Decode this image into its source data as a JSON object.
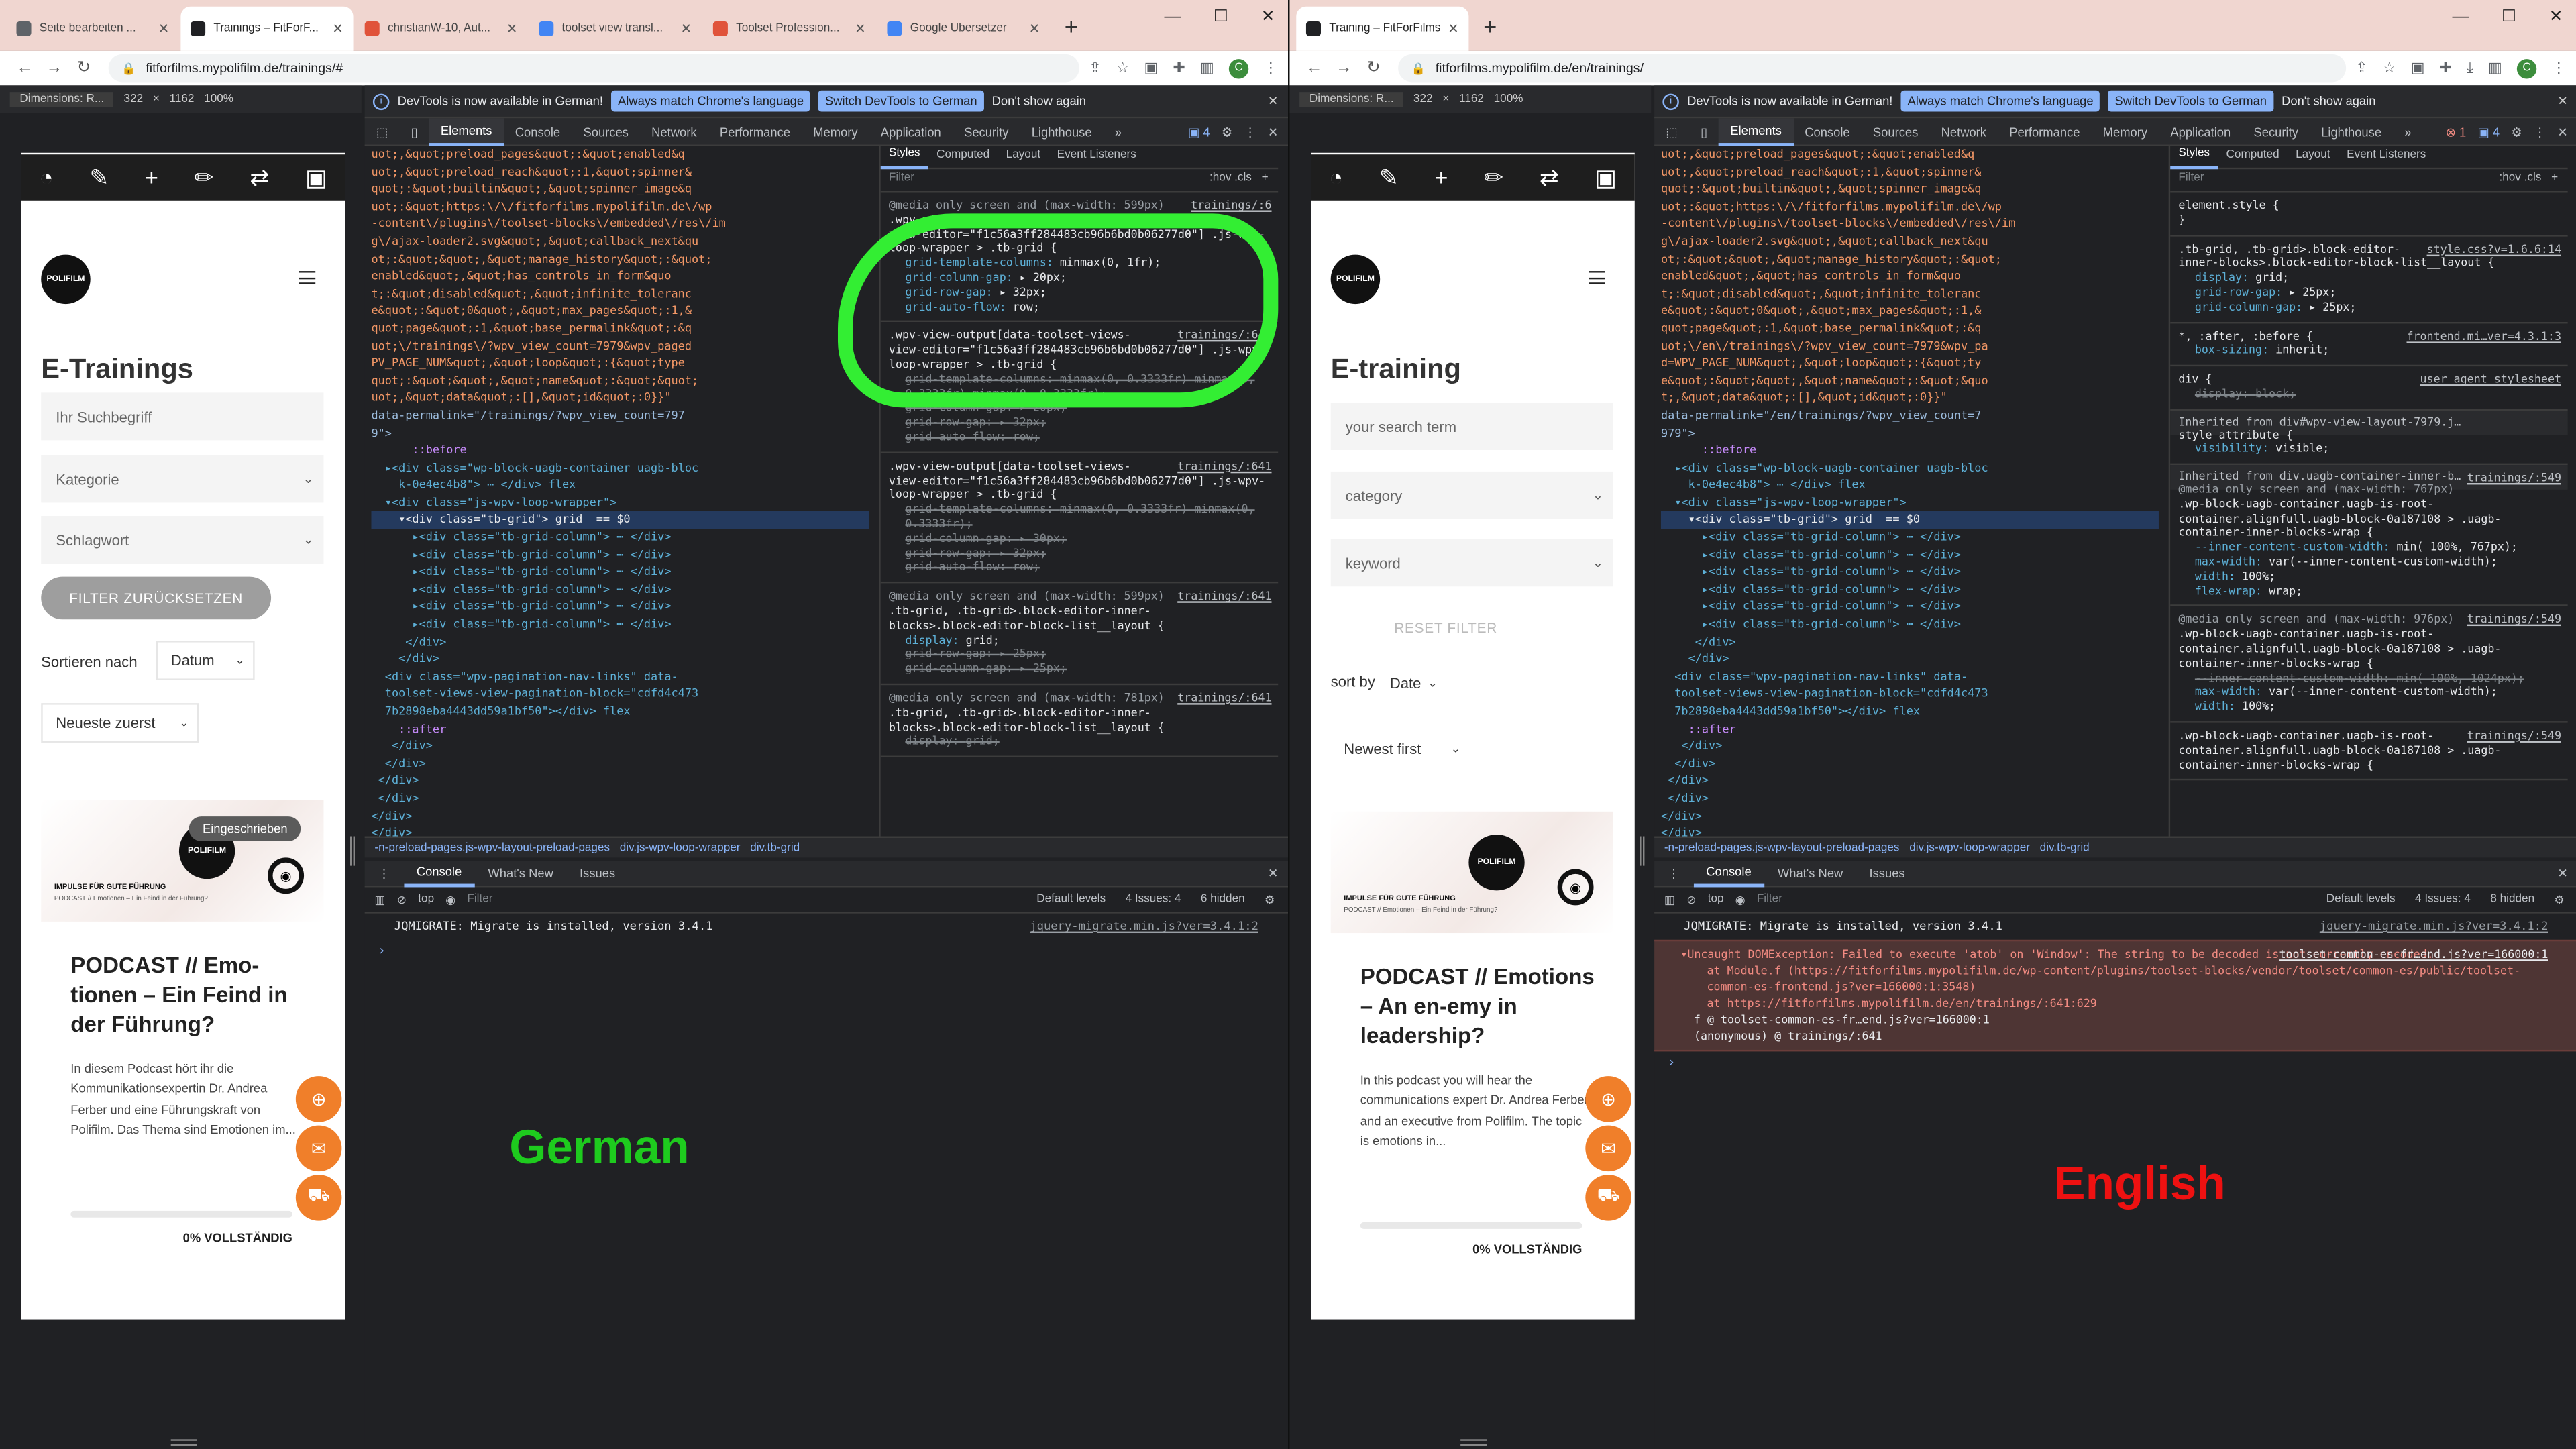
{
  "left": {
    "tabs": [
      {
        "title": "Seite bearbeiten ...",
        "color": "#5f6368"
      },
      {
        "title": "Trainings – FitForF...",
        "color": "#202124",
        "active": true
      },
      {
        "title": "christianW-10, Aut...",
        "color": "#e0533a"
      },
      {
        "title": "toolset view transl...",
        "color": "#4285f4"
      },
      {
        "title": "Toolset Profession...",
        "color": "#e0533a"
      },
      {
        "title": "Google Übersetzer",
        "color": "#4285f4"
      }
    ],
    "url": "fitforfilms.mypolifilm.de/trainings/#",
    "device": {
      "dims_label": "Dimensions: R...",
      "width": "322",
      "height": "1162",
      "zoom": "100%"
    },
    "devtools_info": {
      "text": "DevTools is now available in German!",
      "btn1": "Always match Chrome's language",
      "btn2": "Switch DevTools to German",
      "btn3": "Don't show again"
    },
    "issues_count": "4",
    "page": {
      "title": "E-Trainings",
      "search_placeholder": "Ihr Suchbegriff",
      "category": "Kategorie",
      "keyword": "Schlagwort",
      "reset": "FILTER ZURÜCKSETZEN",
      "sort_label": "Sortieren nach",
      "sort_by": "Datum",
      "order": "Neueste zuerst",
      "badge": "Eingeschrieben",
      "card_title": "PODCAST // Emo-tionen – Ein Feind in der Führung?",
      "card_desc": "In diesem Podcast hört ihr die Kommunikationsexpertin Dr. Andrea Ferber und eine Führungskraft von Polifilm. Das Thema sind Emotionen im...",
      "progress_label": "0% VOLLSTÄNDIG",
      "progress": 0
    },
    "elements_lines": [
      [
        "c-str",
        "uot;,&quot;preload_pages&quot;:&quot;enabled&q"
      ],
      [
        "c-str",
        "uot;,&quot;preload_reach&quot;:1,&quot;spinner&"
      ],
      [
        "c-str",
        "quot;:&quot;builtin&quot;,&quot;spinner_image&q"
      ],
      [
        "c-str",
        "uot;:&quot;https:\\/\\/fitforfilms.mypolifilm.de\\/wp"
      ],
      [
        "c-str",
        "-content\\/plugins\\/toolset-blocks\\/embedded\\/res\\/im"
      ],
      [
        "c-str",
        "g\\/ajax-loader2.svg&quot;,&quot;callback_next&qu"
      ],
      [
        "c-str",
        "ot;:&quot;&quot;,&quot;manage_history&quot;:&quot;"
      ],
      [
        "c-str",
        "enabled&quot;,&quot;has_controls_in_form&quo"
      ],
      [
        "c-str",
        "t;:&quot;disabled&quot;,&quot;infinite_toleranc"
      ],
      [
        "c-str",
        "e&quot;:&quot;0&quot;,&quot;max_pages&quot;:1,&"
      ],
      [
        "c-str",
        "quot;page&quot;:1,&quot;base_permalink&quot;:&q"
      ],
      [
        "c-str",
        "uot;\\/trainings\\/?wpv_view_count=7979&wpv_paged"
      ],
      [
        "c-str",
        "PV_PAGE_NUM&quot;,&quot;loop&quot;:{&quot;type"
      ],
      [
        "c-str",
        "quot;:&quot;&quot;,&quot;name&quot;:&quot;&quot;"
      ],
      [
        "c-str",
        "uot;,&quot;data&quot;:[],&quot;id&quot;:0}}\""
      ],
      [
        "c-attr",
        "data-permalink=\"/trainings/?wpv_view_count=797"
      ],
      [
        "c-attr",
        "9\">"
      ],
      [
        "c-pseudo",
        "      ::before"
      ],
      [
        "c-tag",
        "  ▸<div class=\"wp-block-uagb-container uagb-bloc"
      ],
      [
        "c-tag",
        "    k-0e4ec4b8\"> ⋯ </div> flex"
      ],
      [
        "c-tag",
        "  ▾<div class=\"js-wpv-loop-wrapper\">"
      ],
      [
        "hl",
        "    ▾<div class=\"tb-grid\"> grid  == $0"
      ],
      [
        "c-tag",
        "      ▸<div class=\"tb-grid-column\"> ⋯ </div>"
      ],
      [
        "c-tag",
        "      ▸<div class=\"tb-grid-column\"> ⋯ </div>"
      ],
      [
        "c-tag",
        "      ▸<div class=\"tb-grid-column\"> ⋯ </div>"
      ],
      [
        "c-tag",
        "      ▸<div class=\"tb-grid-column\"> ⋯ </div>"
      ],
      [
        "c-tag",
        "      ▸<div class=\"tb-grid-column\"> ⋯ </div>"
      ],
      [
        "c-tag",
        "      ▸<div class=\"tb-grid-column\"> ⋯ </div>"
      ],
      [
        "c-tag",
        "     </div>"
      ],
      [
        "c-tag",
        "    </div>"
      ],
      [
        "c-tag",
        "  <div class=\"wpv-pagination-nav-links\" data-"
      ],
      [
        "c-tag",
        "  toolset-views-view-pagination-block=\"cdfd4c473"
      ],
      [
        "c-tag",
        "  7b2898eba4443dd59a1bf50\"></div> flex"
      ],
      [
        "c-pseudo",
        "    ::after"
      ],
      [
        "c-tag",
        "   </div>"
      ],
      [
        "c-tag",
        "  </div>"
      ],
      [
        "c-tag",
        " </div>"
      ],
      [
        "c-tag",
        " </div>"
      ],
      [
        "c-tag",
        "</div>"
      ],
      [
        "c-tag",
        "</div>"
      ],
      [
        "c-pseudo",
        "::after"
      ]
    ],
    "styles_rules": [
      {
        "sel": "@media only screen and (max-width: 599px)\n.wpv-view-output[data-toolset-views-\nview-editor=\"f1c56a3ff284483cb96b6bd0b06277d0\"] .js-wpv-\nloop-wrapper > .tb-grid {",
        "src": "trainings/:6",
        "props": [
          [
            "grid-template-columns",
            "minmax(0, 1fr);",
            false
          ],
          [
            "grid-column-gap",
            "▸ 20px;",
            false
          ],
          [
            "grid-row-gap",
            "▸ 32px;",
            false
          ],
          [
            "grid-auto-flow",
            "row;",
            false
          ]
        ]
      },
      {
        "sel": ".wpv-view-output[data-toolset-views-\nview-editor=\"f1c56a3ff284483cb96b6bd0b06277d0\"] .js-wpv-\nloop-wrapper > .tb-grid {",
        "src": "trainings/:641",
        "props": [
          [
            "grid-template-columns",
            "minmax(0, 0.3333fr) minmax(0, 0.3333fr) minmax(0, 0.3333fr);",
            true
          ],
          [
            "grid-column-gap",
            "▸ 20px;",
            true
          ],
          [
            "grid-row-gap",
            "▸ 32px;",
            true
          ],
          [
            "grid-auto-flow",
            "row;",
            true
          ]
        ]
      },
      {
        "sel": ".wpv-view-output[data-toolset-views-\nview-editor=\"f1c56a3ff284483cb96b6bd0b06277d0\"] .js-wpv-\nloop-wrapper > .tb-grid {",
        "src": "trainings/:641",
        "props": [
          [
            "grid-template-columns",
            "minmax(0, 0.3333fr) minmax(0, 0.3333fr);",
            true
          ],
          [
            "grid-column-gap",
            "▸ 30px;",
            true
          ],
          [
            "grid-row-gap",
            "▸ 32px;",
            true
          ],
          [
            "grid-auto-flow",
            "row;",
            true
          ]
        ]
      },
      {
        "sel": "@media only screen and (max-width: 599px)\n.tb-grid, .tb-grid>.block-editor-inner-\nblocks>.block-editor-block-list__layout {",
        "src": "trainings/:641",
        "props": [
          [
            "display",
            "grid;",
            false
          ],
          [
            "grid-row-gap",
            "▸ 25px;",
            true
          ],
          [
            "grid-column-gap",
            "▸ 25px;",
            true
          ]
        ]
      },
      {
        "sel": "@media only screen and (max-width: 781px)\n.tb-grid, .tb-grid>.block-editor-inner-\nblocks>.block-editor-block-list__layout {",
        "src": "trainings/:641",
        "props": [
          [
            "display",
            "grid;",
            true
          ]
        ]
      }
    ],
    "breadcrumb": [
      "-n-preload-pages.js-wpv-layout-preload-pages",
      "div.js-wpv-loop-wrapper",
      "div.tb-grid"
    ],
    "console_tabs": [
      "Console",
      "What's New",
      "Issues"
    ],
    "console_toolbar": {
      "context": "top",
      "filter": "Filter",
      "levels": "Default levels",
      "issues": "4 Issues: 4",
      "hidden": "6 hidden"
    },
    "console_msg": "JQMIGRATE: Migrate is installed, version 3.4.1",
    "console_src": "jquery-migrate.min.js?ver=3.4.1:2",
    "label": "German",
    "label_color": "#1ecb1e"
  },
  "right": {
    "tabs": [
      {
        "title": "Training – FitForFilms",
        "color": "#202124",
        "active": true
      }
    ],
    "url": "fitforfilms.mypolifilm.de/en/trainings/",
    "device": {
      "dims_label": "Dimensions: R...",
      "width": "322",
      "height": "1162",
      "zoom": "100%"
    },
    "devtools_info": {
      "text": "DevTools is now available in German!",
      "btn1": "Always match Chrome's language",
      "btn2": "Switch DevTools to German",
      "btn3": "Don't show again"
    },
    "errors_count": "1",
    "issues_count": "4",
    "page": {
      "title": "E-training",
      "search_placeholder": "your search term",
      "category": "category",
      "keyword": "keyword",
      "reset": "RESET FILTER",
      "sort_label": "sort by",
      "sort_by": "Date",
      "order": "Newest first",
      "card_title": "PODCAST // Emotions – An en-emy in leadership?",
      "card_desc": "In this podcast you will hear the communications expert Dr. Andrea Ferber and an executive from Polifilm. The topic is emotions in...",
      "progress_label": "0% VOLLSTÄNDIG",
      "progress": 0
    },
    "elements_lines": [
      [
        "c-str",
        "uot;,&quot;preload_pages&quot;:&quot;enabled&q"
      ],
      [
        "c-str",
        "uot;,&quot;preload_reach&quot;:1,&quot;spinner&"
      ],
      [
        "c-str",
        "quot;:&quot;builtin&quot;,&quot;spinner_image&q"
      ],
      [
        "c-str",
        "uot;:&quot;https:\\/\\/fitforfilms.mypolifilm.de\\/wp"
      ],
      [
        "c-str",
        "-content\\/plugins\\/toolset-blocks\\/embedded\\/res\\/im"
      ],
      [
        "c-str",
        "g\\/ajax-loader2.svg&quot;,&quot;callback_next&qu"
      ],
      [
        "c-str",
        "ot;:&quot;&quot;,&quot;manage_history&quot;:&quot;"
      ],
      [
        "c-str",
        "enabled&quot;,&quot;has_controls_in_form&quo"
      ],
      [
        "c-str",
        "t;:&quot;disabled&quot;,&quot;infinite_toleranc"
      ],
      [
        "c-str",
        "e&quot;:&quot;0&quot;,&quot;max_pages&quot;:1,&"
      ],
      [
        "c-str",
        "quot;page&quot;:1,&quot;base_permalink&quot;:&q"
      ],
      [
        "c-str",
        "uot;\\/en\\/trainings\\/?wpv_view_count=7979&wpv_pa"
      ],
      [
        "c-str",
        "d=WPV_PAGE_NUM&quot;,&quot;loop&quot;:{&quot;ty"
      ],
      [
        "c-str",
        "e&quot;:&quot;&quot;,&quot;name&quot;:&quot;&quo"
      ],
      [
        "c-str",
        "t;,&quot;data&quot;:[],&quot;id&quot;:0}}\""
      ],
      [
        "c-attr",
        "data-permalink=\"/en/trainings/?wpv_view_count=7"
      ],
      [
        "c-attr",
        "979\">"
      ],
      [
        "c-pseudo",
        "      ::before"
      ],
      [
        "c-tag",
        "  ▸<div class=\"wp-block-uagb-container uagb-bloc"
      ],
      [
        "c-tag",
        "    k-0e4ec4b8\"> ⋯ </div> flex"
      ],
      [
        "c-tag",
        "  ▾<div class=\"js-wpv-loop-wrapper\">"
      ],
      [
        "hl",
        "    ▾<div class=\"tb-grid\"> grid  == $0"
      ],
      [
        "c-tag",
        "      ▸<div class=\"tb-grid-column\"> ⋯ </div>"
      ],
      [
        "c-tag",
        "      ▸<div class=\"tb-grid-column\"> ⋯ </div>"
      ],
      [
        "c-tag",
        "      ▸<div class=\"tb-grid-column\"> ⋯ </div>"
      ],
      [
        "c-tag",
        "      ▸<div class=\"tb-grid-column\"> ⋯ </div>"
      ],
      [
        "c-tag",
        "      ▸<div class=\"tb-grid-column\"> ⋯ </div>"
      ],
      [
        "c-tag",
        "      ▸<div class=\"tb-grid-column\"> ⋯ </div>"
      ],
      [
        "c-tag",
        "     </div>"
      ],
      [
        "c-tag",
        "    </div>"
      ],
      [
        "c-tag",
        "  <div class=\"wpv-pagination-nav-links\" data-"
      ],
      [
        "c-tag",
        "  toolset-views-view-pagination-block=\"cdfd4c473"
      ],
      [
        "c-tag",
        "  7b2898eba4443dd59a1bf50\"></div> flex"
      ],
      [
        "c-pseudo",
        "    ::after"
      ],
      [
        "c-tag",
        "   </div>"
      ],
      [
        "c-tag",
        "  </div>"
      ],
      [
        "c-tag",
        " </div>"
      ],
      [
        "c-tag",
        " </div>"
      ],
      [
        "c-tag",
        "</div>"
      ],
      [
        "c-tag",
        "</div>"
      ],
      [
        "c-pseudo",
        "::after"
      ]
    ],
    "styles_rules": [
      {
        "sel": "element.style {\n}",
        "src": "",
        "props": []
      },
      {
        "sel": ".tb-grid, .tb-grid>.block-editor-\ninner-blocks>.block-editor-block-list__layout {",
        "src": "style.css?v=1.6.6:14",
        "props": [
          [
            "display",
            "grid;",
            false
          ],
          [
            "grid-row-gap",
            "▸ 25px;",
            false
          ],
          [
            "grid-column-gap",
            "▸ 25px;",
            false
          ]
        ]
      },
      {
        "sel": "*, :after, :before {",
        "src": "frontend.mi…ver=4.3.1:3",
        "props": [
          [
            "box-sizing",
            "inherit;",
            false
          ]
        ]
      },
      {
        "sel": "div {",
        "src": "user agent stylesheet",
        "props": [
          [
            "display",
            "block;",
            true
          ]
        ]
      },
      {
        "sel": "Inherited from div#wpv-view-layout-7979.j…\nstyle attribute {",
        "src": "",
        "props": [
          [
            "visibility",
            "visible;",
            false
          ]
        ]
      },
      {
        "sel": "Inherited from div.uagb-container-inner-b…\n@media only screen and (max-width: 767px)\n.wp-block-uagb-container.uagb-is-root-\ncontainer.alignfull.uagb-block-0a187108 > .uagb-\ncontainer-inner-blocks-wrap {",
        "src": "trainings/:549",
        "props": [
          [
            "--inner-content-custom-width",
            "min( 100%, 767px);",
            false
          ],
          [
            "max-width",
            "var(--inner-content-custom-width);",
            false
          ],
          [
            "width",
            "100%;",
            false
          ],
          [
            "flex-wrap",
            "wrap;",
            false
          ]
        ]
      },
      {
        "sel": "@media only screen and (max-width: 976px)\n.wp-block-uagb-container.uagb-is-root-\ncontainer.alignfull.uagb-block-0a187108 > .uagb-\ncontainer-inner-blocks-wrap {",
        "src": "trainings/:549",
        "props": [
          [
            "--inner-content-custom-width",
            "min( 100%, 1024px);",
            true
          ],
          [
            "max-width",
            "var(--inner-content-custom-width);",
            false
          ],
          [
            "width",
            "100%;",
            false
          ]
        ]
      },
      {
        "sel": ".wp-block-uagb-container.uagb-is-root-\ncontainer.alignfull.uagb-block-0a187108 > .uagb-\ncontainer-inner-blocks-wrap {",
        "src": "trainings/:549",
        "props": []
      }
    ],
    "breadcrumb": [
      "-n-preload-pages.js-wpv-layout-preload-pages",
      "div.js-wpv-loop-wrapper",
      "div.tb-grid"
    ],
    "console_tabs": [
      "Console",
      "What's New",
      "Issues"
    ],
    "console_toolbar": {
      "context": "top",
      "filter": "Filter",
      "levels": "Default levels",
      "issues": "4 Issues: 4",
      "hidden": "8 hidden"
    },
    "console_msg": "JQMIGRATE: Migrate is installed, version 3.4.1",
    "console_src": "jquery-migrate.min.js?ver=3.4.1:2",
    "error": {
      "line1": "▾Uncaught DOMException: Failed to execute 'atob' on 'Window': The string to be decoded is not correctly encoded.",
      "src1": "toolset-common-es-fr…end.js?ver=166000:1",
      "line2": "at Module.f (https://fitforfilms.mypolifilm.de/wp-content/plugins/toolset-blocks/vendor/toolset/common-es/public/toolset-common-es-frontend.js?ver=166000:1:3548)",
      "line3": "at https://fitforfilms.mypolifilm.de/en/trainings/:641:629",
      "line4": "f          @ toolset-common-es-fr…end.js?ver=166000:1",
      "line5": "(anonymous) @ trainings/:641"
    },
    "label": "English",
    "label_color": "#ee1111"
  },
  "devtools_tabs": [
    "Elements",
    "Console",
    "Sources",
    "Network",
    "Performance",
    "Memory",
    "Application",
    "Security",
    "Lighthouse"
  ],
  "styles_tabs": [
    "Styles",
    "Computed",
    "Layout",
    "Event Listeners"
  ],
  "styles_filter": "Filter",
  "styles_tools": ":hov .cls"
}
